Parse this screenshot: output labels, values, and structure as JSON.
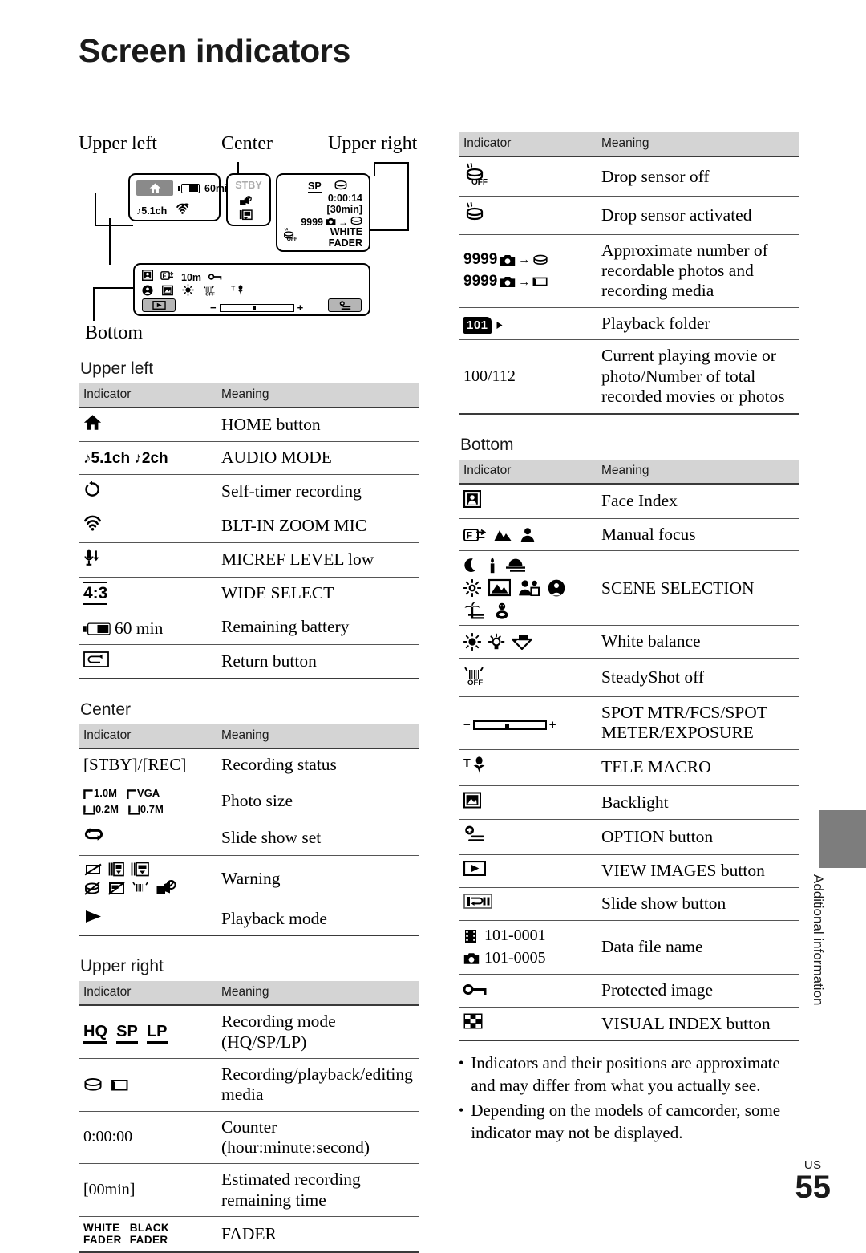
{
  "page": {
    "title": "Screen indicators",
    "folio_prefix": "US",
    "folio_number": "55",
    "side_tab_label": "Additional information",
    "header_indicator": "Indicator",
    "header_meaning": "Meaning",
    "accent_gray": "#d4d4d4",
    "tab_gray": "#7d7d7d"
  },
  "diagram": {
    "label_upper_left": "Upper left",
    "label_center": "Center",
    "label_upper_right": "Upper right",
    "label_bottom": "Bottom",
    "upper_left_box": {
      "home_icon": "home-icon",
      "battery_icon": "battery-icon",
      "battery_text": "60mi",
      "audio_text": "5.1ch",
      "mic_icon": "zoom-mic-icon"
    },
    "center_box": {
      "status": "STBY",
      "icons": [
        "lens-cover-warning-icon",
        "media-warning-icon"
      ]
    },
    "upper_right_box": {
      "rec_mode": "SP",
      "media_icon": "hdd-icon",
      "counter": "0:00:14",
      "remaining": "[30min]",
      "photo_count": "9999",
      "photo_icon": "camera-icon",
      "arrow": "→",
      "dest_icon": "hdd-icon",
      "drop_sensor": "OFF",
      "fader_line1": "WHITE",
      "fader_line2": "FADER"
    },
    "bottom_box": {
      "row1": [
        "face-index-icon",
        "manual-focus-icon",
        "10m",
        "protected-icon"
      ],
      "row2": [
        "spotlight-icon",
        "backlight-icon",
        "white-balance-icon",
        "steadyshot-off-icon",
        "tele-macro-icon"
      ],
      "view_images_button": "view-images-icon",
      "exposure_minus": "−",
      "exposure_plus": "+",
      "option_button": "option-icon"
    }
  },
  "sections": {
    "upper_left": {
      "heading": "Upper left",
      "rows": [
        {
          "icon": "home-icon",
          "meaning": "HOME button"
        },
        {
          "icon": "audio-mode-icon",
          "text": "5.1ch",
          "text2": "2ch",
          "meaning": "AUDIO MODE"
        },
        {
          "icon": "self-timer-icon",
          "meaning": "Self-timer recording"
        },
        {
          "icon": "zoom-mic-icon",
          "meaning": "BLT-IN ZOOM MIC"
        },
        {
          "icon": "micref-level-icon",
          "meaning": "MICREF LEVEL low"
        },
        {
          "icon": "wide-select-icon",
          "text": "4:3",
          "meaning": "WIDE SELECT"
        },
        {
          "icon": "battery-icon",
          "text": "60 min",
          "meaning": "Remaining battery"
        },
        {
          "icon": "return-button-icon",
          "meaning": "Return button"
        }
      ]
    },
    "center": {
      "heading": "Center",
      "rows": [
        {
          "text": "[STBY]/[REC]",
          "meaning": "Recording status"
        },
        {
          "icon": "photo-size-icon",
          "sizes": [
            "1.0M",
            "VGA",
            "0.2M",
            "0.7M"
          ],
          "meaning": "Photo size"
        },
        {
          "icon": "slide-show-set-icon",
          "meaning": "Slide show set"
        },
        {
          "icon": "warning-icons",
          "meaning": "Warning"
        },
        {
          "icon": "playback-mode-icon",
          "meaning": "Playback mode"
        }
      ]
    },
    "upper_right": {
      "heading": "Upper right",
      "rows": [
        {
          "text": "HQ",
          "text2": "SP",
          "text3": "LP",
          "icon": "rec-mode-icon",
          "meaning": "Recording mode (HQ/SP/LP)"
        },
        {
          "icon": "media-icons",
          "meaning": "Recording/playback/editing media"
        },
        {
          "text": "0:00:00",
          "meaning": "Counter (hour:minute:second)"
        },
        {
          "text": "[00min]",
          "meaning": "Estimated recording remaining time"
        },
        {
          "icon": "fader-icon",
          "text": "WHITE FADER",
          "text2": "BLACK FADER",
          "meaning": "FADER"
        }
      ]
    },
    "right_top": {
      "rows": [
        {
          "icon": "drop-sensor-off-icon",
          "meaning": "Drop sensor off"
        },
        {
          "icon": "drop-sensor-on-icon",
          "meaning": "Drop sensor activated"
        },
        {
          "icon": "recordable-photos-icon",
          "text": "9999",
          "text2": "9999",
          "meaning": "Approximate number of recordable photos and recording media"
        },
        {
          "icon": "playback-folder-icon",
          "text": "101",
          "meaning": "Playback folder"
        },
        {
          "text": "100/112",
          "meaning": "Current playing movie or photo/Number of total recorded movies or photos"
        }
      ]
    },
    "bottom": {
      "heading": "Bottom",
      "rows": [
        {
          "icon": "face-index-icon",
          "meaning": "Face Index"
        },
        {
          "icon": "manual-focus-icons",
          "meaning": "Manual focus"
        },
        {
          "icon": "scene-selection-icons",
          "meaning": "SCENE SELECTION"
        },
        {
          "icon": "white-balance-icons",
          "meaning": "White balance"
        },
        {
          "icon": "steadyshot-off-icon",
          "meaning": "SteadyShot off"
        },
        {
          "icon": "exposure-bar-icon",
          "meaning": "SPOT MTR/FCS/SPOT METER/EXPOSURE"
        },
        {
          "icon": "tele-macro-icon",
          "meaning": "TELE MACRO"
        },
        {
          "icon": "backlight-icon",
          "meaning": "Backlight"
        },
        {
          "icon": "option-icon",
          "meaning": "OPTION button"
        },
        {
          "icon": "view-images-icon",
          "meaning": "VIEW IMAGES button"
        },
        {
          "icon": "slide-show-button-icon",
          "meaning": "Slide show button"
        },
        {
          "icon": "data-file-icons",
          "text": "101-0001",
          "text2": "101-0005",
          "meaning": "Data file name"
        },
        {
          "icon": "protected-image-icon",
          "meaning": "Protected image"
        },
        {
          "icon": "visual-index-icon",
          "meaning": "VISUAL INDEX button"
        }
      ]
    }
  },
  "notes": [
    "Indicators and their positions are approximate and may differ from what you actually see.",
    "Depending on the models of camcorder, some indicator may not be displayed."
  ]
}
